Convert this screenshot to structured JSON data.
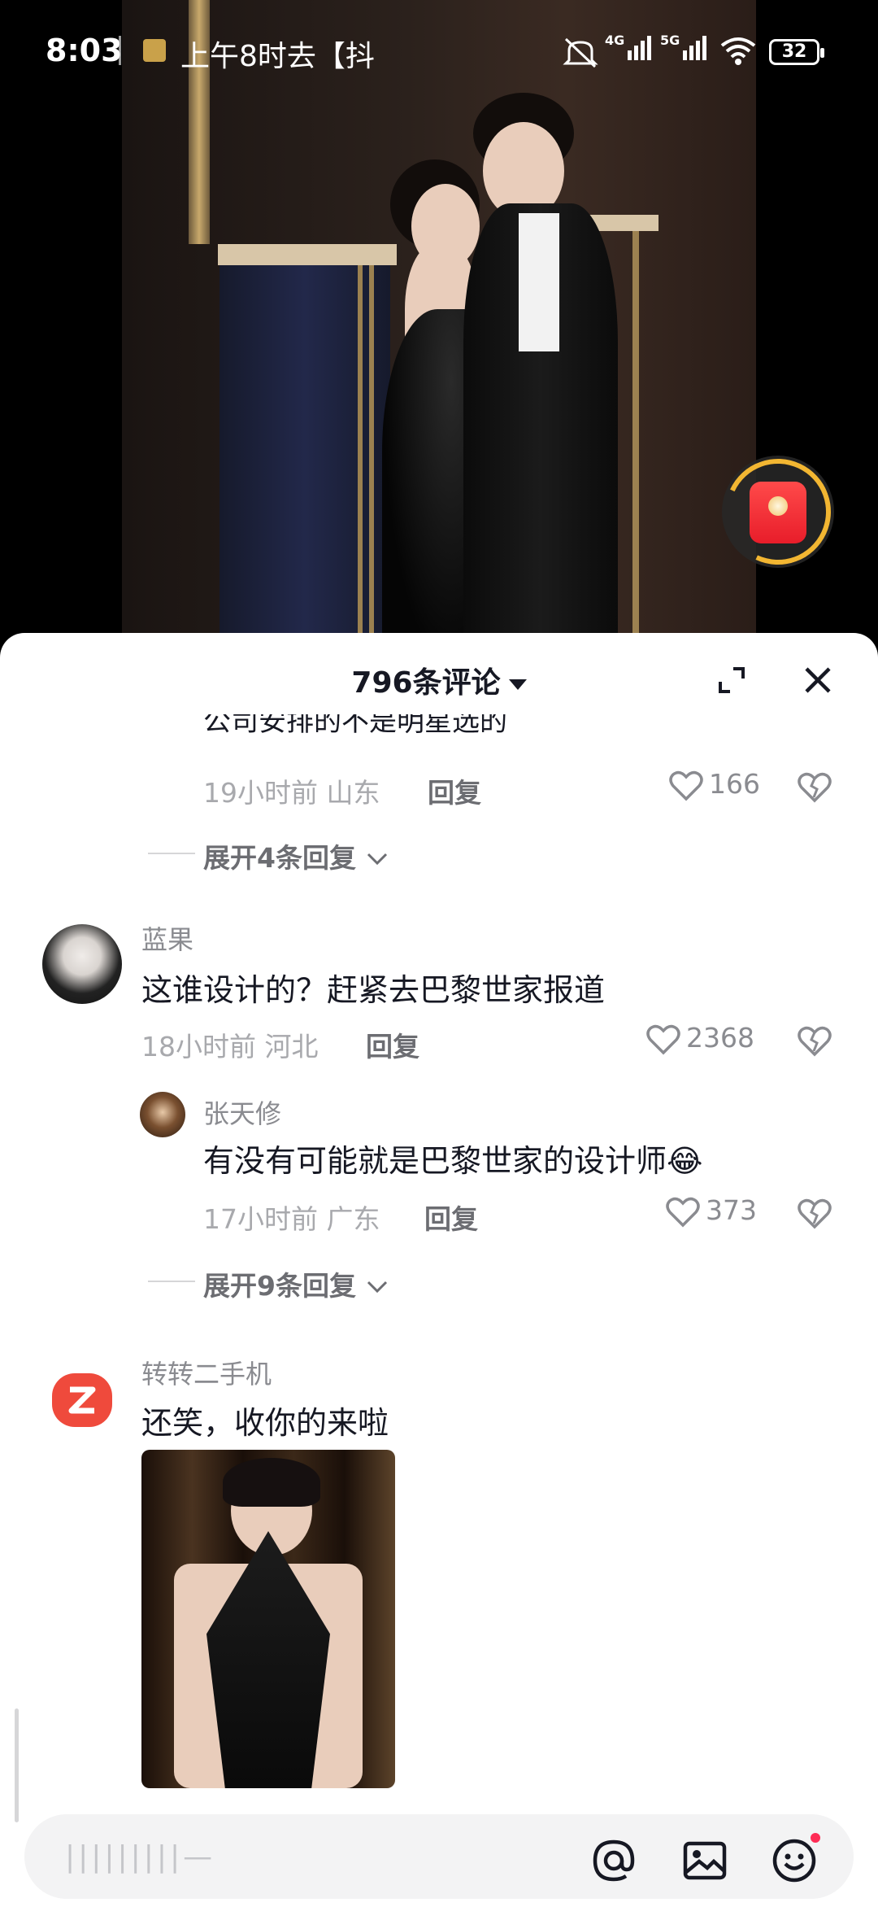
{
  "status_bar": {
    "time": "8:03",
    "notification": "上午8时去【抖",
    "net1": "4G",
    "net2": "5G",
    "battery": "32"
  },
  "comments_header": {
    "title": "796条评论"
  },
  "thread1": {
    "cut_text": "公司安排的不是明星选的",
    "time": "19小时前",
    "location": "山东",
    "reply": "回复",
    "likes": "166",
    "expand": "展开4条回复"
  },
  "comment2": {
    "username": "蓝果",
    "text": "这谁设计的？赶紧去巴黎世家报道",
    "time": "18小时前",
    "location": "河北",
    "reply": "回复",
    "likes": "2368"
  },
  "reply2": {
    "username": "张天修",
    "text": "有没有可能就是巴黎世家的设计师😂",
    "time": "17小时前",
    "location": "广东",
    "reply": "回复",
    "likes": "373",
    "expand": "展开9条回复"
  },
  "comment3": {
    "username": "转转二手机",
    "text": "还笑，收你的来啦"
  },
  "input": {
    "placeholder": "|||||||||—"
  },
  "icons": {
    "close": "close-icon",
    "fullscreen": "expand-icon",
    "mention": "at-icon",
    "image": "image-icon",
    "emoji": "emoji-icon",
    "like": "heart-icon",
    "dislike": "broken-heart-icon",
    "red_packet": "red-envelope-icon"
  },
  "colors": {
    "accent": "#fe2c55",
    "text_primary": "#161823",
    "text_secondary": "#8a8b90"
  }
}
